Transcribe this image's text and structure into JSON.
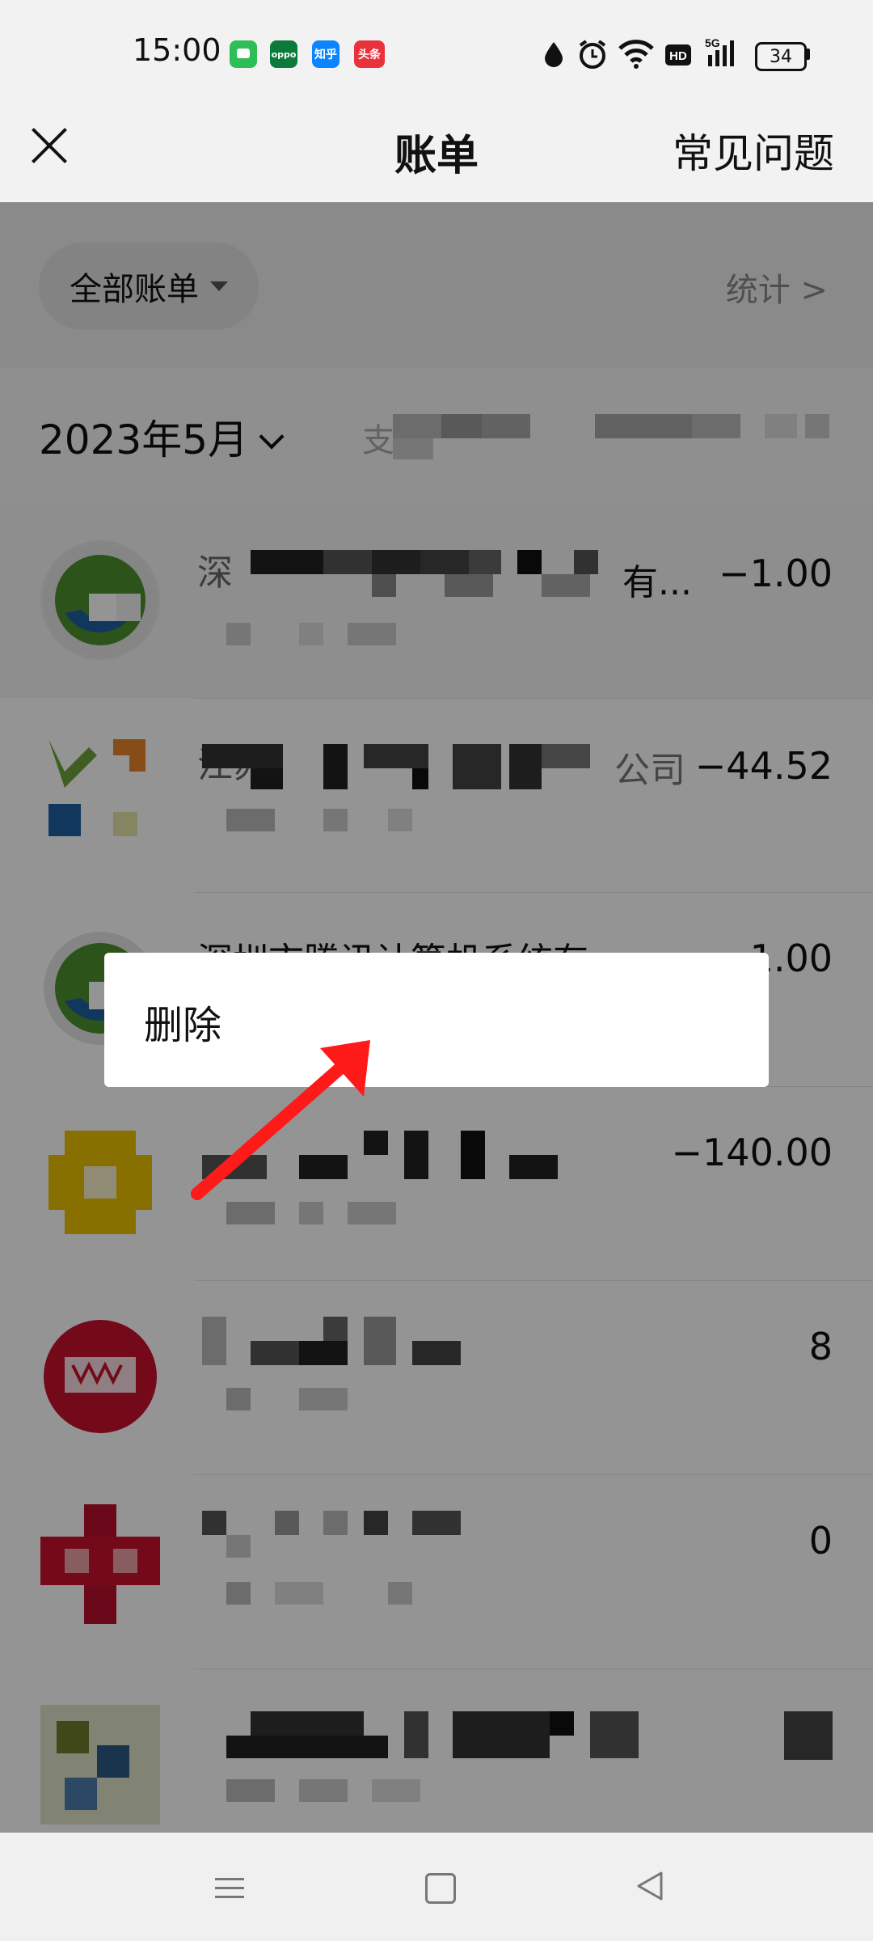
{
  "status_bar": {
    "time": "15:00",
    "apps": [
      {
        "name": "messages-app-icon",
        "label": "",
        "color": "#2dbf55"
      },
      {
        "name": "oppo-app-icon",
        "label": "oppo",
        "color": "#0b7a3b"
      },
      {
        "name": "zhihu-app-icon",
        "label": "知乎",
        "color": "#0a84ff"
      },
      {
        "name": "toutiao-app-icon",
        "label": "头条",
        "color": "#e8333c"
      }
    ],
    "battery": "34"
  },
  "header": {
    "title": "账单",
    "faq": "常见问题"
  },
  "filter": {
    "label": "全部账单",
    "stats": "统计 >"
  },
  "date": {
    "month": "2023年5月",
    "summary": "支"
  },
  "transactions": [
    {
      "title": "深",
      "title_end": "有...",
      "amount": "−1.00",
      "avatar": "tencent-logo"
    },
    {
      "title": "江苏",
      "title_end": "公司",
      "amount": "−44.52",
      "avatar": "merchant-logo-1"
    },
    {
      "title": "深圳市腾讯计算机系统有...",
      "title_end": "",
      "amount": "−1.00",
      "avatar": "tencent-logo"
    },
    {
      "title": "",
      "title_end": "",
      "amount": "−140.00",
      "avatar": "merchant-logo-2"
    },
    {
      "title": "",
      "title_end": "",
      "amount": "8",
      "avatar": "unionpay-logo"
    },
    {
      "title": "",
      "title_end": "",
      "amount": "0",
      "avatar": "merchant-logo-3"
    },
    {
      "title": "",
      "title_end": "",
      "amount": "",
      "avatar": "merchant-logo-4"
    }
  ],
  "popup": {
    "delete_label": "删除"
  },
  "colors": {
    "accent": "#07c160",
    "arrow": "#ff1a1a"
  }
}
